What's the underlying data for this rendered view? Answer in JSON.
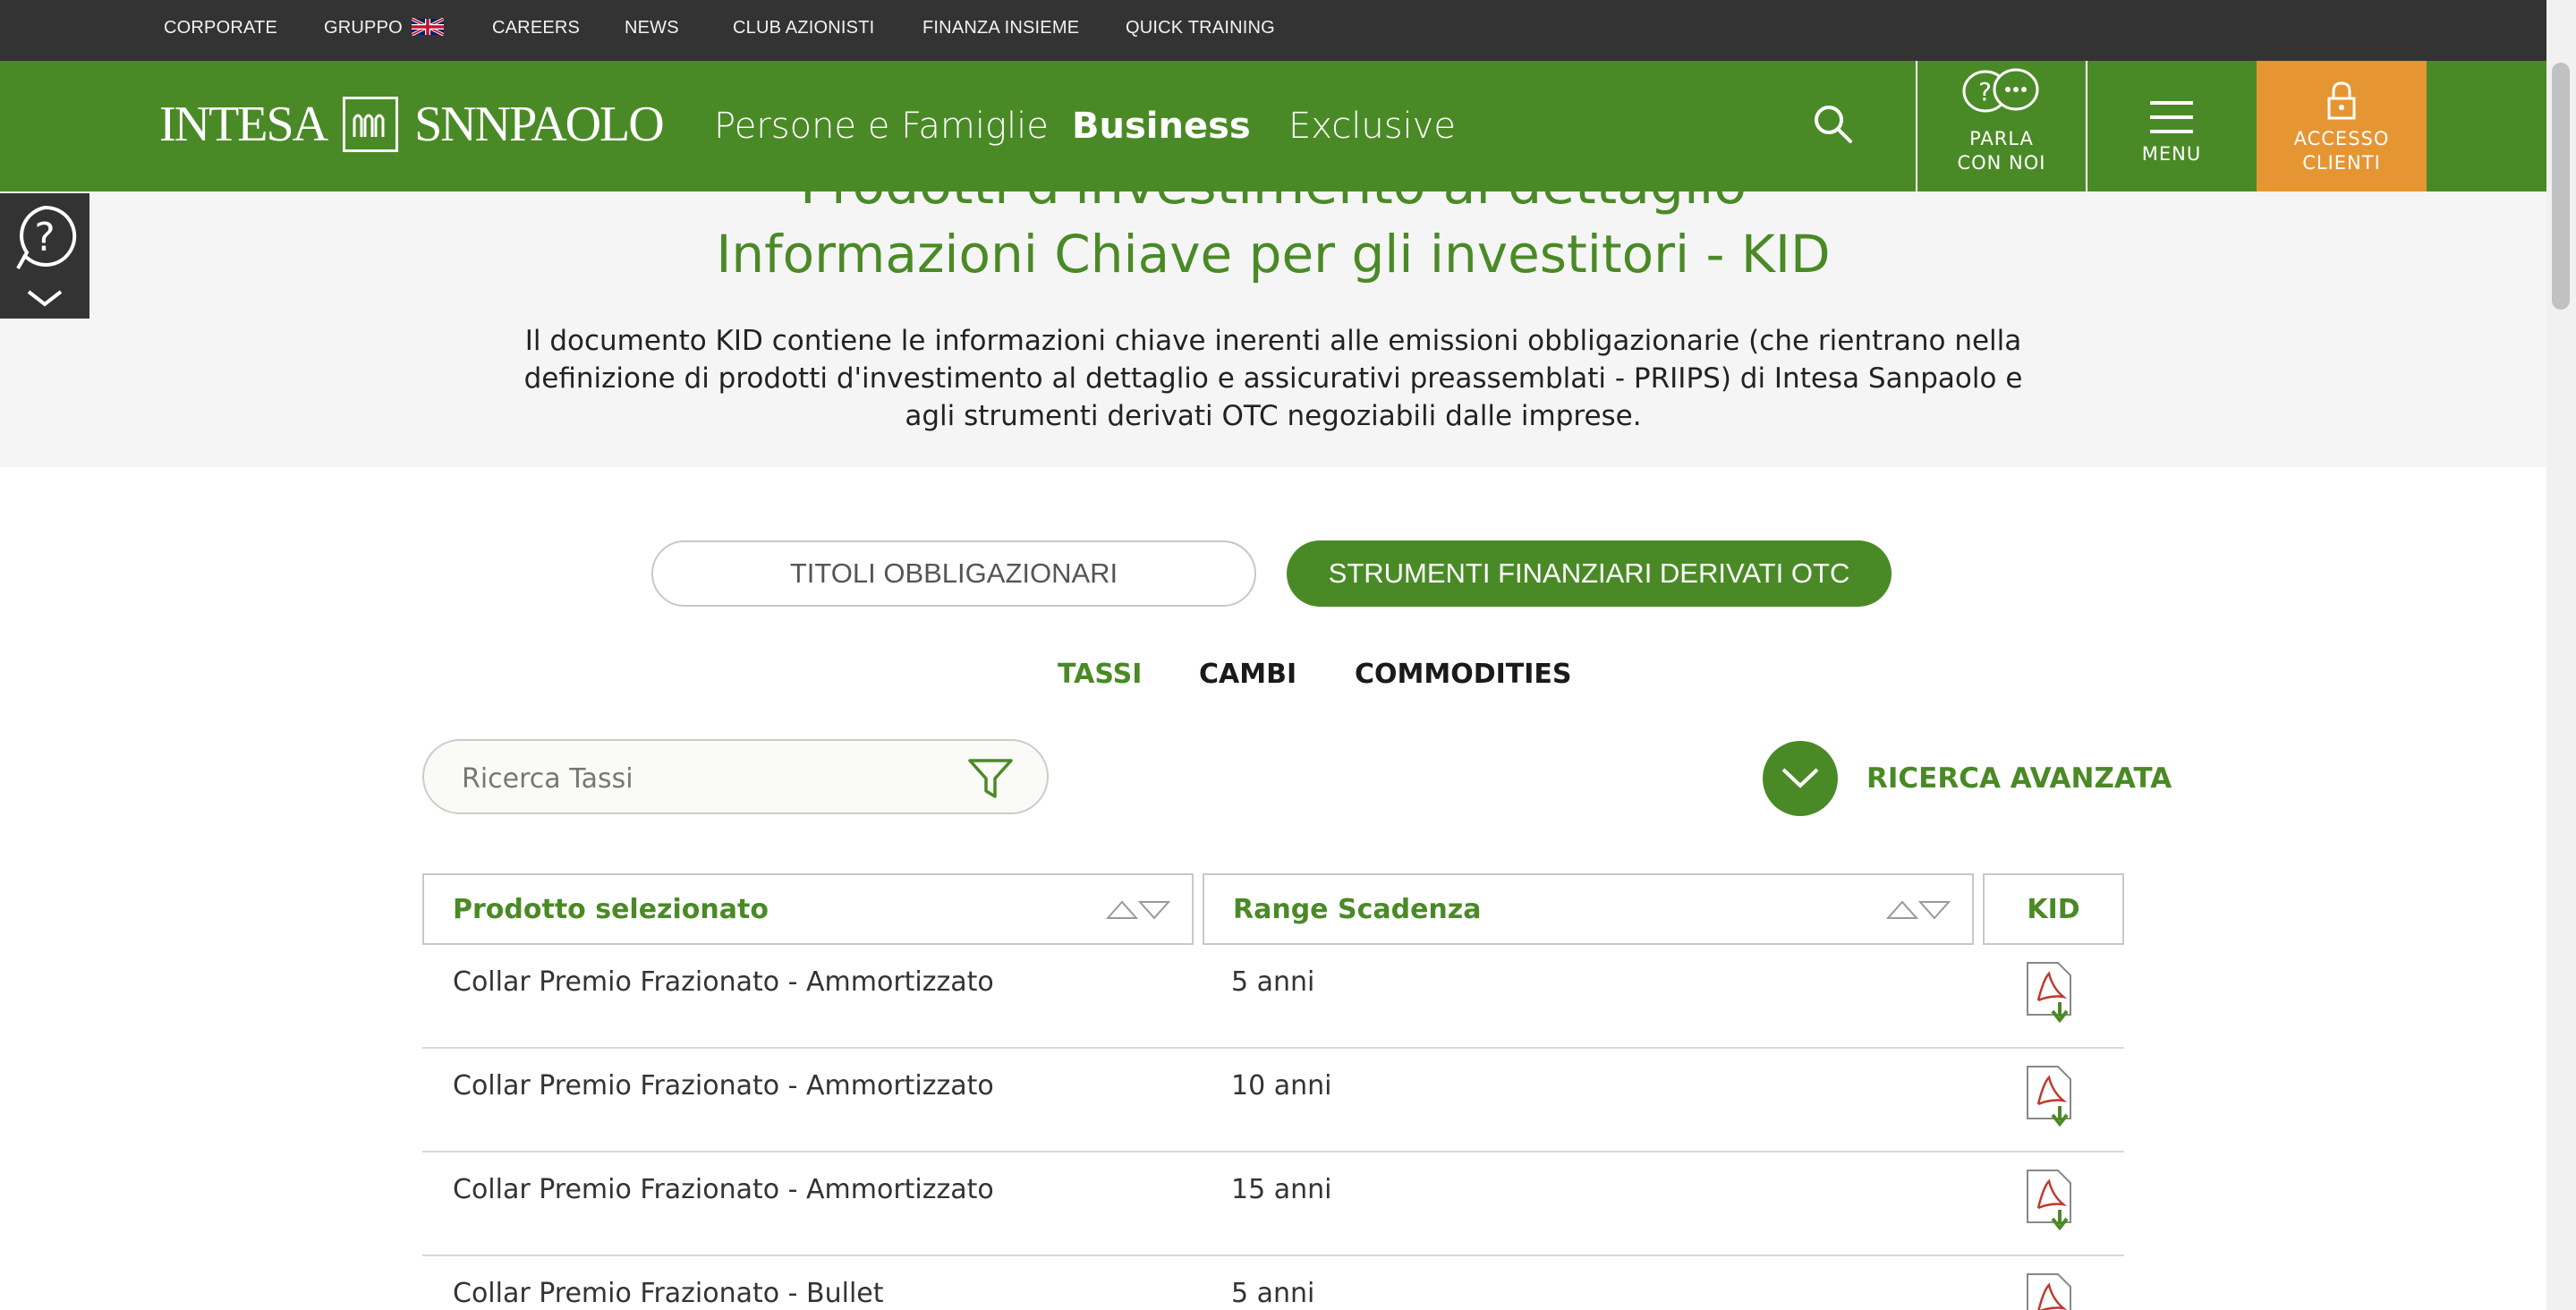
{
  "topbar": {
    "items": [
      "CORPORATE",
      "GRUPPO",
      "CAREERS",
      "NEWS",
      "CLUB AZIONISTI",
      "FINANZA INSIEME",
      "QUICK TRAINING"
    ]
  },
  "header": {
    "logo": {
      "left": "INTESA",
      "right": "SNNPAOLO"
    },
    "nav": [
      "Persone e Famiglie",
      "Business",
      "Exclusive"
    ],
    "parla": [
      "PARLA",
      "CON NOI"
    ],
    "menu": "MENU",
    "accesso": [
      "ACCESSO",
      "CLIENTI"
    ]
  },
  "hero": {
    "cut_title": "Prodotti d'investimento al dettaglio",
    "title": "Informazioni Chiave per gli investitori - KID",
    "description": "Il documento KID contiene le informazioni chiave inerenti alle emissioni obbligazionarie (che rientrano nella definizione di prodotti d'investimento al dettaglio e assicurativi preassemblati - PRIIPS) di Intesa Sanpaolo e agli strumenti derivati OTC negoziabili dalle imprese."
  },
  "toggle": {
    "bonds": "TITOLI OBBLIGAZIONARI",
    "otc": "STRUMENTI FINANZIARI DERIVATI OTC"
  },
  "subtabs": [
    "TASSI",
    "CAMBI",
    "COMMODITIES"
  ],
  "search": {
    "placeholder": "Ricerca Tassi"
  },
  "advanced": "RICERCA AVANZATA",
  "table": {
    "headers": [
      "Prodotto selezionato",
      "Range Scadenza",
      "KID"
    ],
    "rows": [
      {
        "product": "Collar Premio Frazionato - Ammortizzato",
        "range": "5 anni"
      },
      {
        "product": "Collar Premio Frazionato - Ammortizzato",
        "range": "10 anni"
      },
      {
        "product": "Collar Premio Frazionato - Ammortizzato",
        "range": "15 anni"
      },
      {
        "product": "Collar Premio Frazionato - Bullet",
        "range": "5 anni"
      }
    ]
  },
  "colors": {
    "green": "#4a8a26",
    "orange": "#e69533",
    "dark": "#333333"
  }
}
